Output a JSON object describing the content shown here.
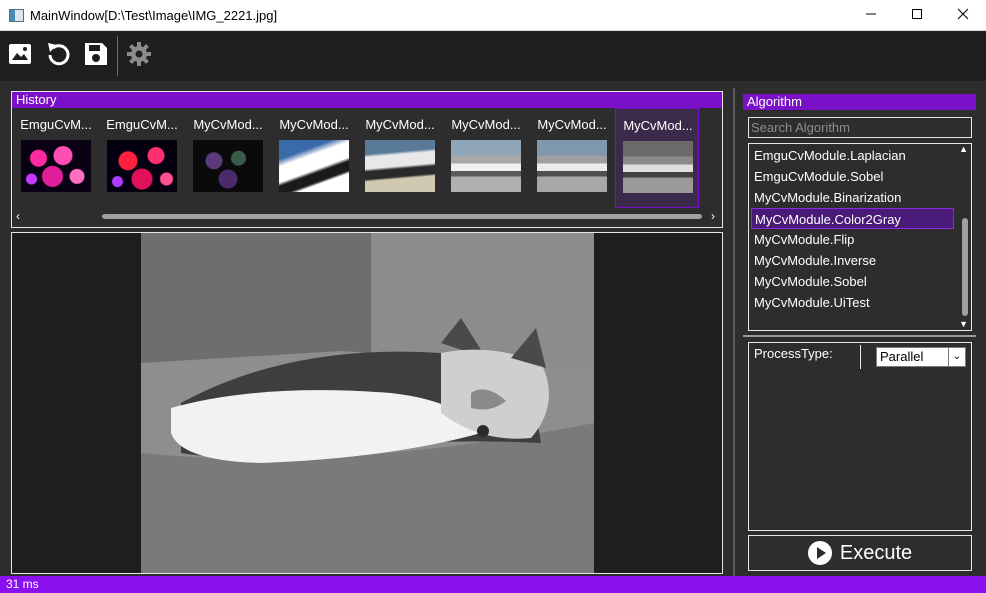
{
  "window": {
    "title": "MainWindow[D:\\Test\\Image\\IMG_2221.jpg]",
    "minimize_icon": "minimize-icon",
    "maximize_icon": "maximize-icon",
    "close_icon": "close-icon"
  },
  "toolbar": {
    "buttons": [
      {
        "icon": "image-icon"
      },
      {
        "icon": "undo-icon"
      },
      {
        "icon": "save-icon"
      },
      {
        "icon": "gear-icon"
      }
    ]
  },
  "history": {
    "header": "History",
    "items": [
      {
        "label": "EmguCvM...",
        "selected": false
      },
      {
        "label": "EmguCvM...",
        "selected": false
      },
      {
        "label": "MyCvMod...",
        "selected": false
      },
      {
        "label": "MyCvMod...",
        "selected": false
      },
      {
        "label": "MyCvMod...",
        "selected": false
      },
      {
        "label": "MyCvMod...",
        "selected": false
      },
      {
        "label": "MyCvMod...",
        "selected": false
      },
      {
        "label": "MyCvMod...",
        "selected": true
      }
    ]
  },
  "algorithm": {
    "header": "Algorithm",
    "search_placeholder": "Search Algorithm",
    "items": [
      {
        "label": "EmguCvModule.Laplacian",
        "selected": false
      },
      {
        "label": "EmguCvModule.Sobel",
        "selected": false
      },
      {
        "label": "MyCvModule.Binarization",
        "selected": false
      },
      {
        "label": "MyCvModule.Color2Gray",
        "selected": true
      },
      {
        "label": "MyCvModule.Flip",
        "selected": false
      },
      {
        "label": "MyCvModule.Inverse",
        "selected": false
      },
      {
        "label": "MyCvModule.Sobel",
        "selected": false
      },
      {
        "label": "MyCvModule.UiTest",
        "selected": false
      }
    ]
  },
  "properties": {
    "label": "ProcessType:",
    "value": "Parallel"
  },
  "execute": {
    "label": "Execute"
  },
  "status": {
    "text": "31 ms"
  },
  "colors": {
    "accent": "#7a10c8",
    "status": "#8a10f0",
    "background": "#2d2d2d"
  }
}
